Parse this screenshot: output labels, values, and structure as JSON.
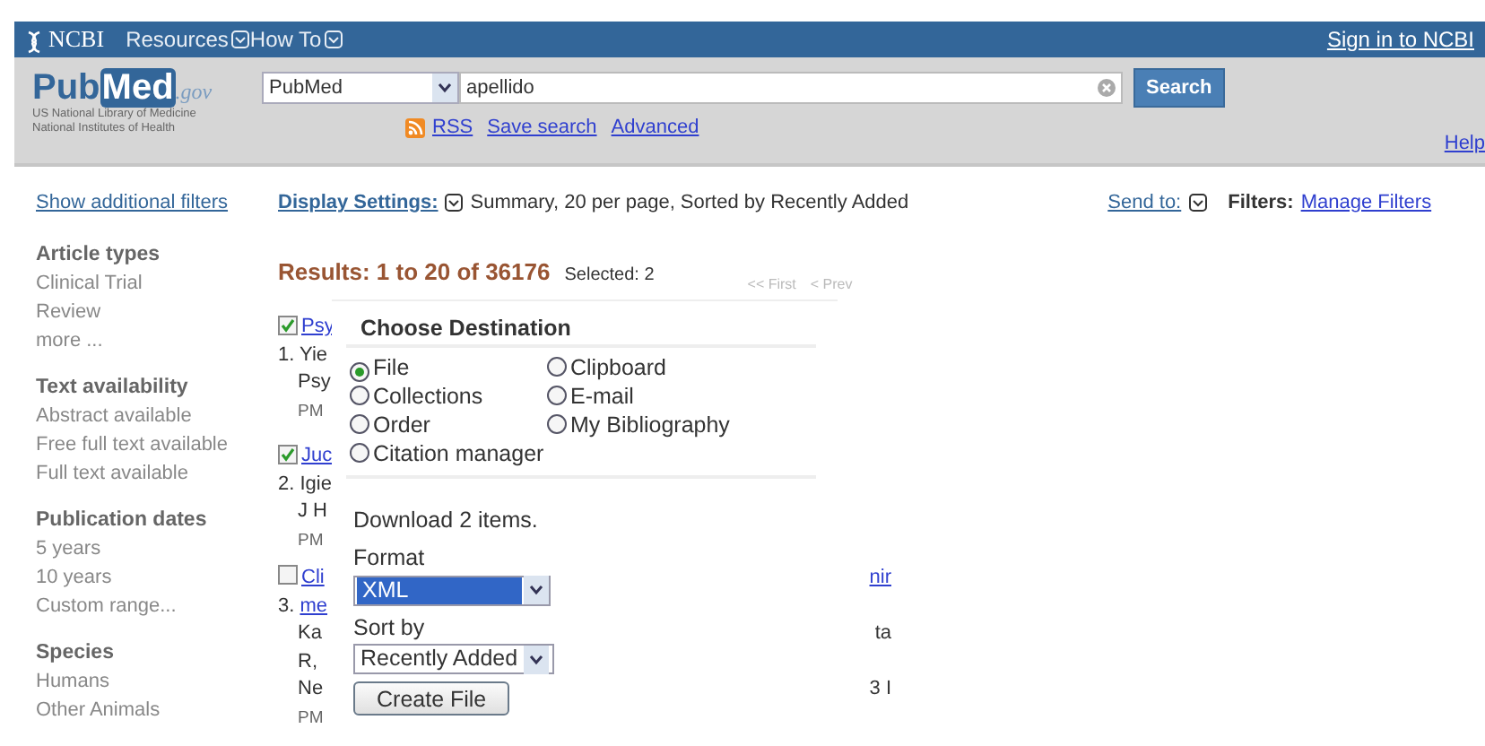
{
  "top_bar": {
    "logo": "NCBI",
    "menus": [
      {
        "label": "Resources"
      },
      {
        "label": "How To"
      }
    ],
    "sign_in": "Sign in to NCBI"
  },
  "header": {
    "brand": "Pub",
    "brand_m": "Med",
    "brand_suffix": ".gov",
    "subtitle": [
      "US National Library of Medicine",
      "National Institutes of Health"
    ],
    "database": "PubMed",
    "query": "apellido",
    "search_button": "Search",
    "links": [
      "RSS",
      "Save search",
      "Advanced"
    ],
    "help": "Help"
  },
  "sidebar": {
    "show_filters": "Show additional filters",
    "sections": [
      {
        "title": "Article types",
        "items": [
          "Clinical Trial",
          "Review",
          "more ..."
        ]
      },
      {
        "title": "Text availability",
        "items": [
          "Abstract available",
          "Free full text available",
          "Full text available"
        ]
      },
      {
        "title": "Publication dates",
        "items": [
          "5 years",
          "10 years",
          "Custom range..."
        ]
      },
      {
        "title": "Species",
        "items": [
          "Humans",
          "Other Animals"
        ]
      }
    ]
  },
  "toolbar": {
    "display_label": "Display Settings:",
    "display_value": "Summary, 20 per page, Sorted by Recently Added",
    "send_to": "Send to:",
    "filters_label": "Filters:",
    "manage_filters": "Manage Filters"
  },
  "results": {
    "heading": "Results: 1 to 20 of 36176",
    "selected_count": "Selected: 2",
    "pager": [
      "<< First",
      "< Prev"
    ],
    "items": [
      {
        "checked": true,
        "title": "Psy",
        "number": "1.",
        "lines": [
          {
            "text": "Yie",
            "kind": "plain"
          },
          {
            "text": "Psy",
            "kind": "plain"
          },
          {
            "text": "PM",
            "kind": "meta"
          }
        ]
      },
      {
        "checked": true,
        "title": "Juc",
        "number": "2.",
        "lines": [
          {
            "text": "Igie",
            "kind": "plain"
          },
          {
            "text": "J H",
            "kind": "plain"
          },
          {
            "text": "PM",
            "kind": "meta"
          }
        ]
      },
      {
        "checked": false,
        "title": "Cli",
        "title_end": "nir",
        "number": "3.",
        "lines": [
          {
            "text": "me",
            "kind": "link"
          },
          {
            "text": "Ka",
            "right": "ta",
            "kind": "plain"
          },
          {
            "text": "R,",
            "kind": "plain"
          },
          {
            "text": "Ne",
            "right": "3 I",
            "kind": "plain"
          },
          {
            "text": "PM",
            "kind": "meta"
          }
        ]
      }
    ]
  },
  "popup": {
    "title": "Choose Destination",
    "destinations": [
      {
        "label": "File",
        "selected": true
      },
      {
        "label": "Clipboard",
        "selected": false
      },
      {
        "label": "Collections",
        "selected": false
      },
      {
        "label": "E-mail",
        "selected": false
      },
      {
        "label": "Order",
        "selected": false
      },
      {
        "label": "My Bibliography",
        "selected": false
      },
      {
        "label": "Citation manager",
        "selected": false
      }
    ],
    "download_text": "Download 2 items.",
    "format_label": "Format",
    "format_value": "XML",
    "sort_label": "Sort by",
    "sort_value": "Recently Added",
    "button": "Create File"
  }
}
